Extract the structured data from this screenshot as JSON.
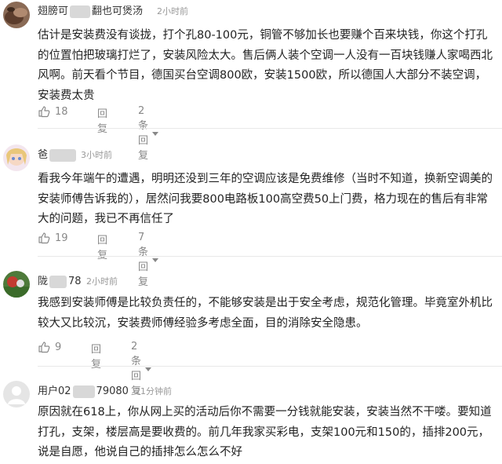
{
  "comments": [
    {
      "user_prefix": "翅膀可",
      "user_suffix": "翻也可煲汤",
      "time": "2小时前",
      "text": "估计是安装费没有谈拢，打个孔80-100元，铜管不够加长也要赚个百来块钱，你这个打孔的位置怕把玻璃打烂了，安装风险太大。售后俩人装个空调一人没有一百块钱赚人家喝西北风啊。前天看个节目，德国买台空调800欧，安装1500欧，所以德国人大部分不装空调，安装费太贵",
      "likes": "18",
      "reply_label": "回复",
      "replies_label": "2条回复"
    },
    {
      "user_prefix": "爸",
      "user_suffix": "",
      "time": "3小时前",
      "text": "看我今年端午的遭遇，明明还没到三年的空调应该是免费维修（当时不知道，换新空调美的安装师傅告诉我的），居然问我要800电路板100高空费50上门费，格力现在的售后有非常大的问题，我已不再信任了",
      "likes": "19",
      "reply_label": "回复",
      "replies_label": "7条回复"
    },
    {
      "user_prefix": "陇",
      "user_suffix": "78",
      "time": "2小时前",
      "text": "我感到安装师傅是比较负责任的，不能够安装是出于安全考虑，规范化管理。毕竟室外机比较大又比较沉，安装费师傅经验多考虑全面，目的消除安全隐患。",
      "likes": "9",
      "reply_label": "回复",
      "replies_label": "2条回复"
    },
    {
      "user_prefix": "用户02",
      "user_suffix": "79080",
      "time": "21分钟前",
      "text": "原因就在618上，你从网上买的活动后你不需要一分钱就能安装，安装当然不干喽。要知道打孔，支架，楼层高是要收费的。前几年我家买彩电，支架100元和150的，插排200元，说是自愿，他说自己的插排怎么怎么不好"
    }
  ]
}
